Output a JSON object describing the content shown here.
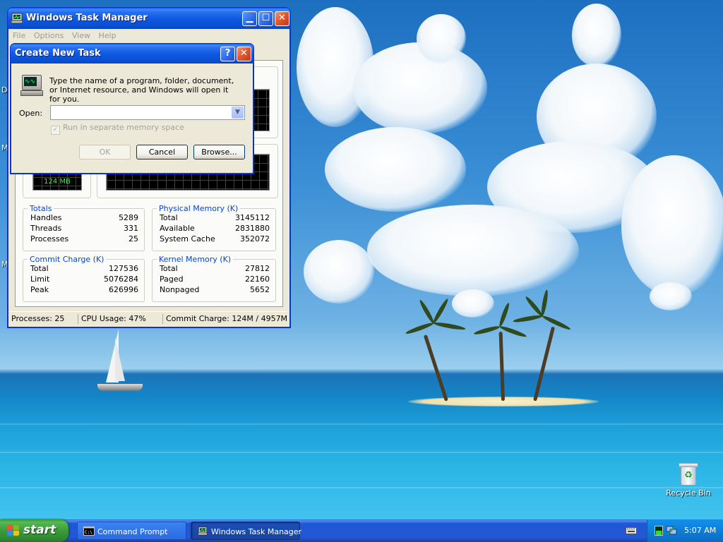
{
  "task_manager": {
    "title": "Windows Task Manager",
    "menu": [
      "File",
      "Options",
      "View",
      "Help"
    ],
    "pf_usage": "124 MB",
    "totals": {
      "title": "Totals",
      "rows": [
        {
          "label": "Handles",
          "value": "5289"
        },
        {
          "label": "Threads",
          "value": "331"
        },
        {
          "label": "Processes",
          "value": "25"
        }
      ]
    },
    "physical_memory": {
      "title": "Physical Memory (K)",
      "rows": [
        {
          "label": "Total",
          "value": "3145112"
        },
        {
          "label": "Available",
          "value": "2831880"
        },
        {
          "label": "System Cache",
          "value": "352072"
        }
      ]
    },
    "commit_charge": {
      "title": "Commit Charge (K)",
      "rows": [
        {
          "label": "Total",
          "value": "127536"
        },
        {
          "label": "Limit",
          "value": "5076284"
        },
        {
          "label": "Peak",
          "value": "626996"
        }
      ]
    },
    "kernel_memory": {
      "title": "Kernel Memory (K)",
      "rows": [
        {
          "label": "Total",
          "value": "27812"
        },
        {
          "label": "Paged",
          "value": "22160"
        },
        {
          "label": "Nonpaged",
          "value": "5652"
        }
      ]
    },
    "status": {
      "processes": "Processes: 25",
      "cpu": "CPU Usage: 47%",
      "commit": "Commit Charge: 124M / 4957M"
    }
  },
  "dialog": {
    "title": "Create New Task",
    "description": "Type the name of a program, folder, document, or Internet resource, and Windows will open it for you.",
    "open_label": "Open:",
    "open_value": "",
    "checkbox_label": "Run in separate memory space",
    "checkbox_checked": true,
    "ok_label": "OK",
    "cancel_label": "Cancel",
    "browse_label": "Browse..."
  },
  "desktop": {
    "recycle_bin_label": "Recycle Bin",
    "edge_letters": [
      "D",
      "M",
      "M"
    ]
  },
  "taskbar": {
    "start_label": "start",
    "items": [
      {
        "label": "Command Prompt",
        "active": false
      },
      {
        "label": "Windows Task Manager",
        "active": true
      }
    ],
    "clock": "5:07 AM"
  },
  "colors": {
    "title_blue": "#0a4fd1",
    "start_green": "#3a9b3a",
    "graph_green": "#25ff25",
    "group_title": "#0046d5"
  }
}
